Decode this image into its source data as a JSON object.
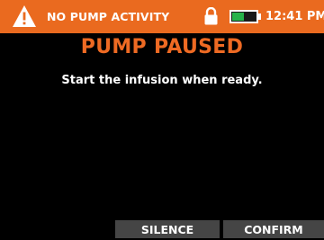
{
  "status_bar": {
    "alert_icon": "warning-triangle-icon",
    "status_text": "NO PUMP ACTIVITY",
    "lock_icon": "lock-icon",
    "battery_icon": "battery-icon",
    "battery_level": 0.5,
    "time": "12:41 PM",
    "background_color": "#ea6a1f"
  },
  "alarm": {
    "title": "PUMP PAUSED",
    "message": "Start the infusion when ready.",
    "title_color": "#ee6a23"
  },
  "soft_keys": {
    "silence_label": "SILENCE",
    "confirm_label": "CONFIRM"
  }
}
